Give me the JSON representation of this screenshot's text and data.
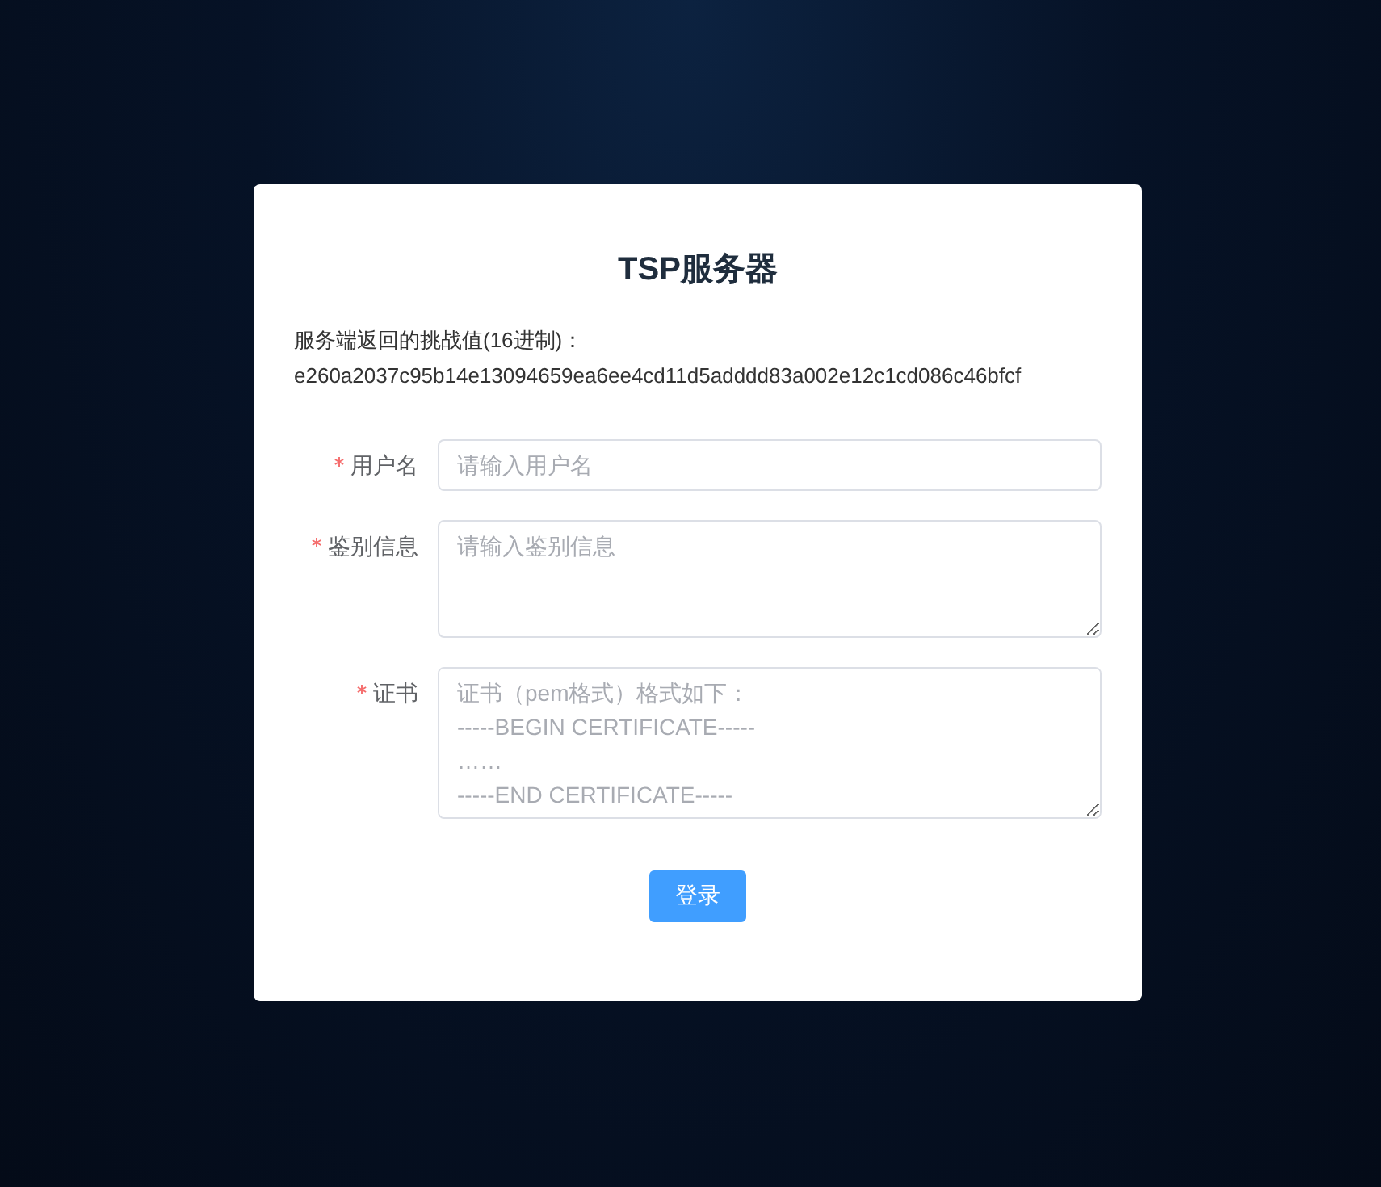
{
  "title": "TSP服务器",
  "challenge": {
    "label": "服务端返回的挑战值(16进制)：",
    "value": "e260a2037c95b14e13094659ea6ee4cd11d5adddd83a002e12c1cd086c46bfcf"
  },
  "fields": [
    {
      "kind": "input",
      "label": "用户名",
      "required": true,
      "placeholder": "请输入用户名"
    },
    {
      "kind": "textarea",
      "label": "鉴别信息",
      "required": true,
      "placeholder": "请输入鉴别信息"
    },
    {
      "kind": "textarea",
      "label": "证书",
      "required": true,
      "placeholder": "证书（pem格式）格式如下：\n-----BEGIN CERTIFICATE-----\n……\n-----END CERTIFICATE-----"
    }
  ],
  "submit": "登录"
}
